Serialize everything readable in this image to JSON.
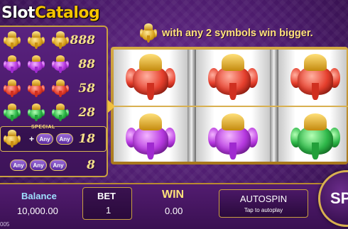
{
  "logo": {
    "part1": "Slot",
    "part2": "Catalog"
  },
  "banner": {
    "icon": "gold-ganesh-icon",
    "text": "with any 2 symbols win bigger."
  },
  "paytable": {
    "rows": [
      {
        "symbol": "gold-ganesh",
        "count": 3,
        "payout": "888"
      },
      {
        "symbol": "purple-ganesh",
        "count": 3,
        "payout": "88"
      },
      {
        "symbol": "red-ganesh",
        "count": 3,
        "payout": "58"
      },
      {
        "symbol": "green-ganesh",
        "count": 3,
        "payout": "28"
      }
    ],
    "special": {
      "label": "SPECIAL",
      "any_label": "Any",
      "payout": "18"
    },
    "any_row": {
      "any_label": "Any",
      "payout": "8"
    }
  },
  "reels": [
    [
      "red-ganesh",
      "purple-ganesh"
    ],
    [
      "red-ganesh",
      "purple-ganesh"
    ],
    [
      "red-ganesh",
      "green-ganesh"
    ]
  ],
  "balance": {
    "label": "Balance",
    "value": "10,000.00"
  },
  "bet": {
    "label": "BET",
    "value": "1"
  },
  "win": {
    "label": "WIN",
    "value": "0.00"
  },
  "autospin": {
    "label": "AUTOSPIN",
    "sublabel": "Tap to autoplay"
  },
  "spin": {
    "label": "SP"
  },
  "version": "005",
  "colors": {
    "background": "#4a1a6a",
    "gold": "#d8b050",
    "accent_text": "#ffe27a",
    "stat_label": "#9ee0ff"
  }
}
